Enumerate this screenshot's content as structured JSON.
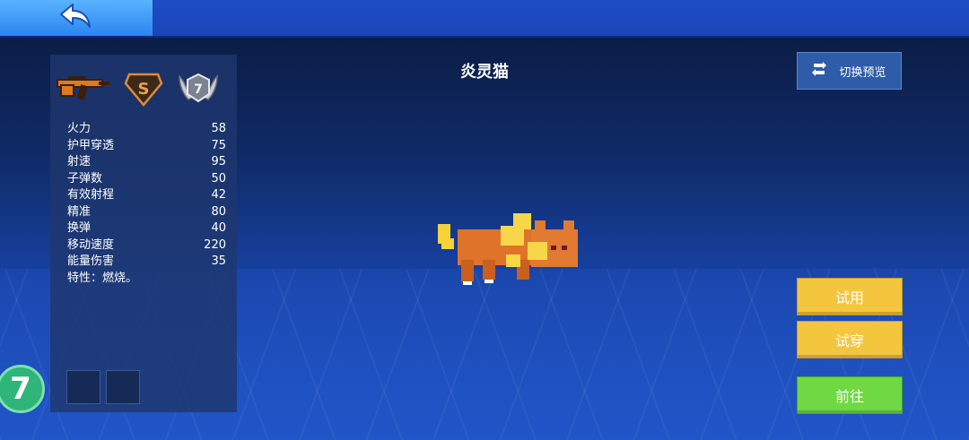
{
  "header": {
    "back_icon": "back-arrow-icon"
  },
  "weapon": {
    "name": "炎灵猫",
    "weapon_icon": "rifle-icon",
    "rarity": "S",
    "level": "7"
  },
  "stats": [
    {
      "label": "火力",
      "value": "58"
    },
    {
      "label": "护甲穿透",
      "value": "75"
    },
    {
      "label": "射速",
      "value": "95"
    },
    {
      "label": "子弹数",
      "value": "50"
    },
    {
      "label": "有效射程",
      "value": "42"
    },
    {
      "label": "精准",
      "value": "80"
    },
    {
      "label": "换弹",
      "value": "40"
    },
    {
      "label": "移动速度",
      "value": "220"
    },
    {
      "label": "能量伤害",
      "value": "35"
    }
  ],
  "trait": "特性：燃烧。",
  "buttons": {
    "switch_preview": "切换预览",
    "try_use": "试用",
    "try_wear": "试穿",
    "go": "前往"
  },
  "player_level_badge": "7",
  "colors": {
    "yellow_button": "#f4c63e",
    "green_button": "#6fd843",
    "top_bar": "#1d4cc6"
  }
}
